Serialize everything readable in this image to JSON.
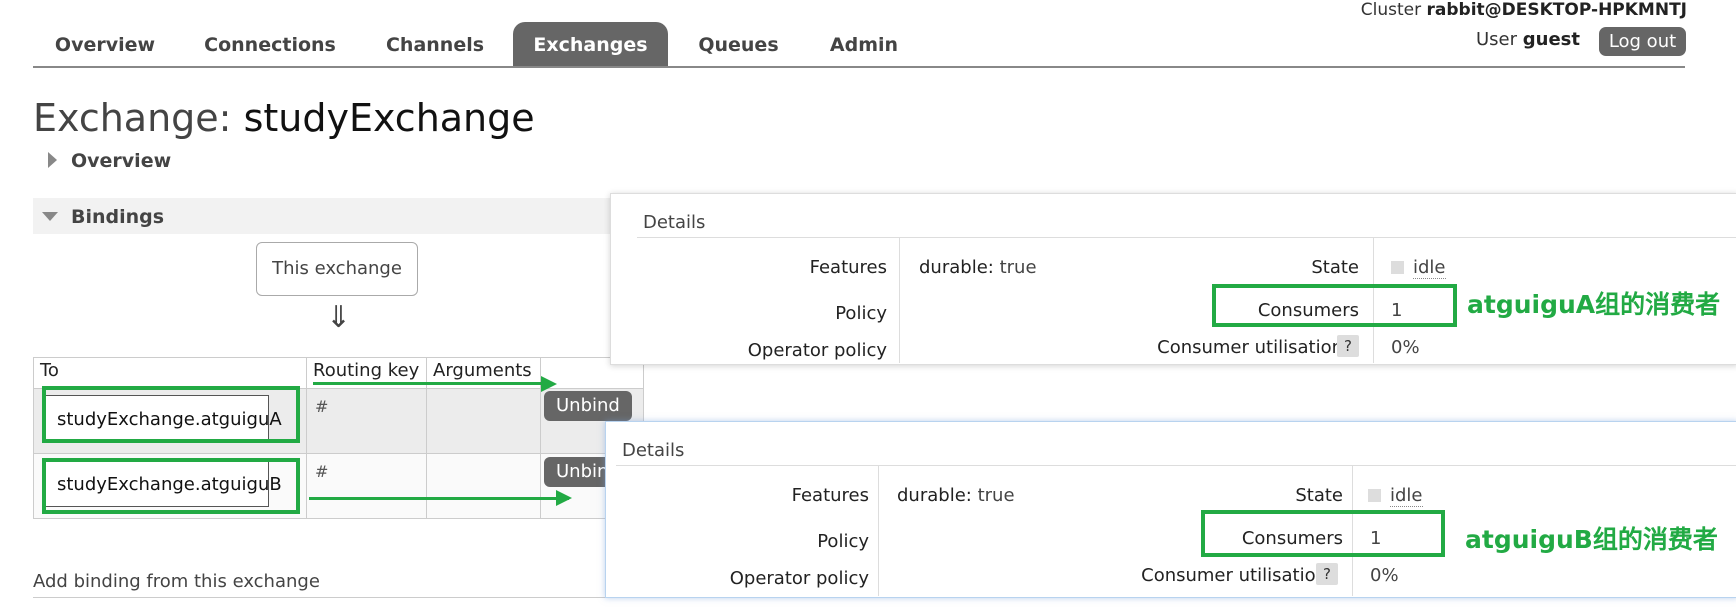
{
  "nav": {
    "tabs": [
      "Overview",
      "Connections",
      "Channels",
      "Exchanges",
      "Queues",
      "Admin"
    ],
    "active_tab": "Exchanges",
    "cluster_label": "Cluster",
    "cluster_name": "rabbit@DESKTOP-HPKMNTJ",
    "user_label": "User",
    "user_name": "guest",
    "logout_label": "Log out"
  },
  "page": {
    "title_prefix": "Exchange:",
    "exchange_name": "studyExchange",
    "overview_section": "Overview",
    "bindings_section": "Bindings",
    "this_exchange": "This exchange",
    "add_binding": "Add binding from this exchange"
  },
  "bindings": {
    "headers": [
      "To",
      "Routing key",
      "Arguments"
    ],
    "rows": [
      {
        "to": "studyExchange.atguiguA",
        "routing_key": "#",
        "action": "Unbind"
      },
      {
        "to": "studyExchange.atguiguB",
        "routing_key": "#",
        "action": "Unbin"
      }
    ]
  },
  "details_a": {
    "title": "Details",
    "features_label": "Features",
    "features_key": "durable:",
    "features_value": "true",
    "policy_label": "Policy",
    "operator_policy_label": "Operator policy",
    "state_label": "State",
    "state_value": "idle",
    "consumers_label": "Consumers",
    "consumers_value": "1",
    "utilisation_label": "Consumer utilisation",
    "utilisation_help": "?",
    "utilisation_value": "0%",
    "annotation": "atguiguA组的消费者"
  },
  "details_b": {
    "title": "Details",
    "features_label": "Features",
    "features_key": "durable:",
    "features_value": "true",
    "policy_label": "Policy",
    "operator_policy_label": "Operator policy",
    "state_label": "State",
    "state_value": "idle",
    "consumers_label": "Consumers",
    "consumers_value": "1",
    "utilisation_label": "Consumer utilisation",
    "utilisation_help": "?",
    "utilisation_value": "0%",
    "annotation": "atguiguB组的消费者"
  },
  "colors": {
    "annotation_green": "#22aa44",
    "tab_active": "#666666"
  }
}
